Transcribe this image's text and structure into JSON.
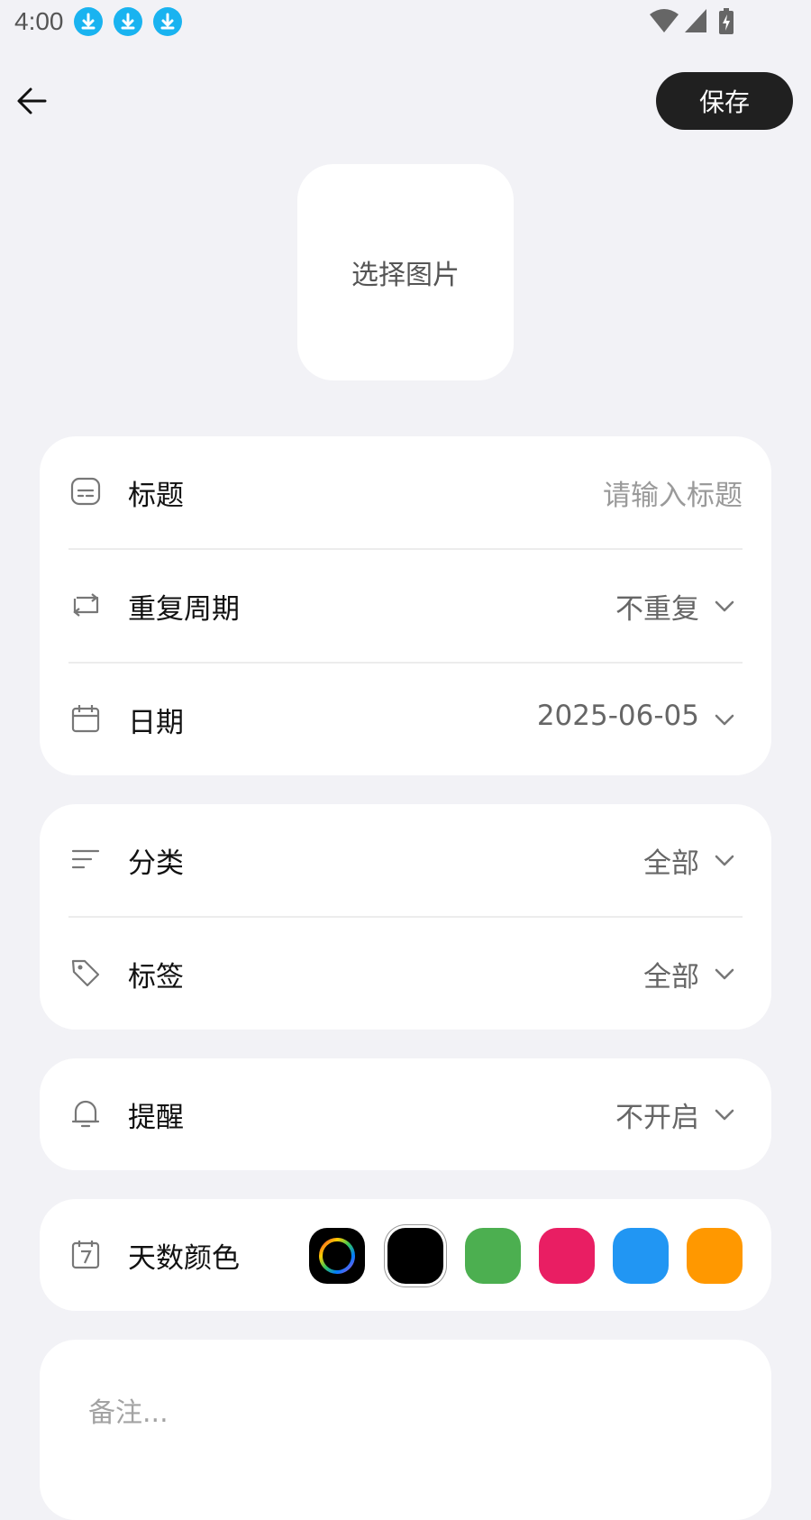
{
  "status_bar": {
    "time": "4:00",
    "icons": [
      "download-icon",
      "download-icon",
      "download-icon",
      "wifi-icon",
      "signal-icon",
      "battery-charging-icon"
    ]
  },
  "header": {
    "save_label": "保存"
  },
  "image_picker": {
    "label": "选择图片"
  },
  "form": {
    "title": {
      "label": "标题",
      "placeholder": "请输入标题",
      "icon": "title-icon"
    },
    "repeat": {
      "label": "重复周期",
      "value": "不重复",
      "icon": "repeat-icon"
    },
    "date": {
      "label": "日期",
      "value": "2025-06-05",
      "icon": "calendar-icon"
    },
    "category": {
      "label": "分类",
      "value": "全部",
      "icon": "category-icon"
    },
    "tag": {
      "label": "标签",
      "value": "全部",
      "icon": "tag-icon"
    },
    "reminder": {
      "label": "提醒",
      "value": "不开启",
      "icon": "bell-icon"
    },
    "day_color": {
      "label": "天数颜色",
      "icon": "calendar-7-icon",
      "swatches": [
        "rainbow",
        "#000000",
        "#4caf50",
        "#e91e63",
        "#2196f3",
        "#ff9800"
      ],
      "selected": "#000000"
    }
  },
  "notes": {
    "placeholder": "备注..."
  }
}
